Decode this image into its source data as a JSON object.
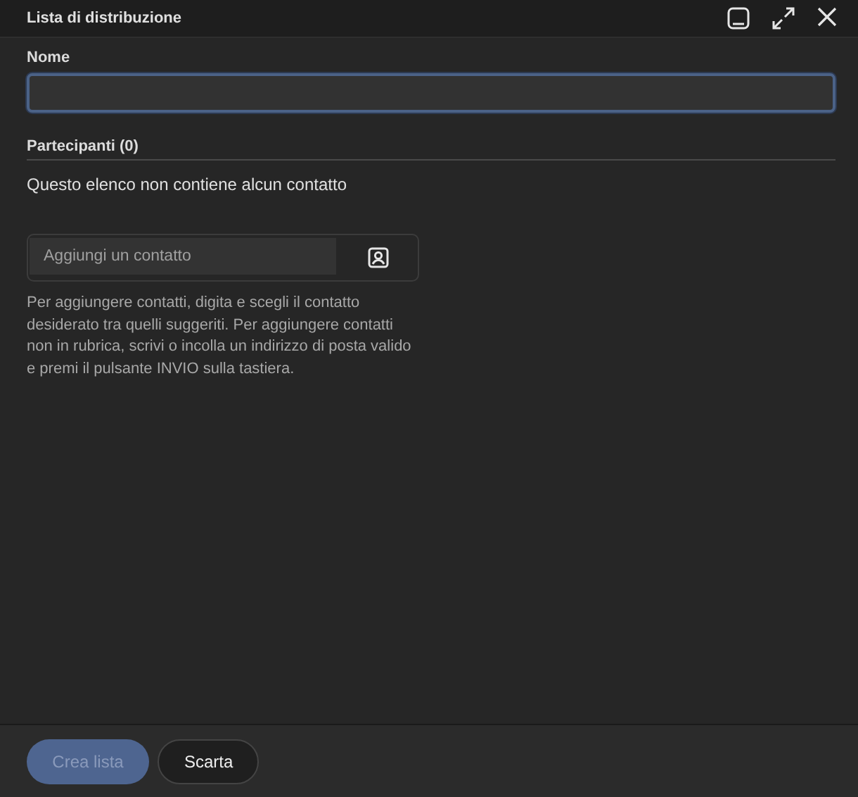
{
  "window": {
    "title": "Lista di distribuzione"
  },
  "name_field": {
    "label": "Nome",
    "focused": true
  },
  "participants": {
    "heading": "Partecipanti (0)",
    "empty_message": "Questo elenco non contiene alcun contatto"
  },
  "add_contact": {
    "placeholder": "Aggiungi un contatto",
    "help": "Per aggiungere contatti, digita e scegli il contatto desiderato tra quelli suggeriti. Per aggiungere contatti non in rubrica, scrivi o incolla un indirizzo di posta valido e premi il pulsante INVIO sulla tastiera."
  },
  "buttons": [
    {
      "label": "Crea lista",
      "kind": "primary",
      "disabled": true
    },
    {
      "label": "Scarta",
      "kind": "secondary",
      "disabled": false
    }
  ]
}
